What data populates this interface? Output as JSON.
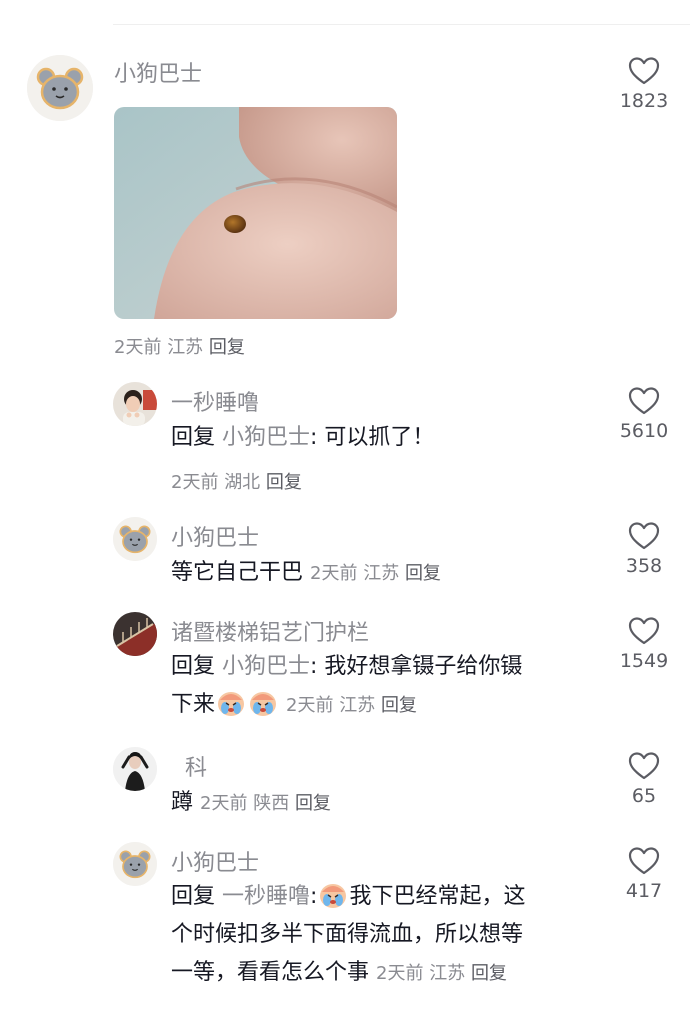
{
  "comments": [
    {
      "user": "小狗巴士",
      "meta": {
        "time": "2天前",
        "location": "江苏",
        "reply_label": "回复"
      },
      "likes": "1823"
    },
    {
      "user": "一秒睡噜",
      "reply_word": "回复",
      "reply_to": "小狗巴士",
      "text": ": 可以抓了！",
      "meta": {
        "time": "2天前",
        "location": "湖北",
        "reply_label": "回复"
      },
      "likes": "5610"
    },
    {
      "user": "小狗巴士",
      "text": "等它自己干巴",
      "meta": {
        "time": "2天前",
        "location": "江苏",
        "reply_label": "回复"
      },
      "likes": "358"
    },
    {
      "user": "诸暨楼梯铝艺门护栏",
      "reply_word": "回复",
      "reply_to": "小狗巴士",
      "text_line1": ": 我好想拿镊子给你镊",
      "text_line2": "下来",
      "meta": {
        "time": "2天前",
        "location": "江苏",
        "reply_label": "回复"
      },
      "likes": "1549"
    },
    {
      "user": "科",
      "text": "蹲",
      "meta": {
        "time": "2天前",
        "location": "陕西",
        "reply_label": "回复"
      },
      "likes": "65"
    },
    {
      "user": "小狗巴士",
      "reply_word": "回复",
      "reply_to": "一秒睡噜",
      "text_line1": "我下巴经常起，这",
      "text_line2": "个时候扣多半下面得流血，所以想等",
      "text_line3": "一等，看看怎么个事",
      "meta": {
        "time": "2天前",
        "location": "江苏",
        "reply_label": "回复"
      },
      "likes": "417"
    }
  ],
  "icons": {
    "like": "heart-outline-icon",
    "emoji": "crying-face-emoji"
  },
  "colors": {
    "text": "#161823",
    "secondary": "#8a8b91",
    "action": "#5b5c63"
  }
}
